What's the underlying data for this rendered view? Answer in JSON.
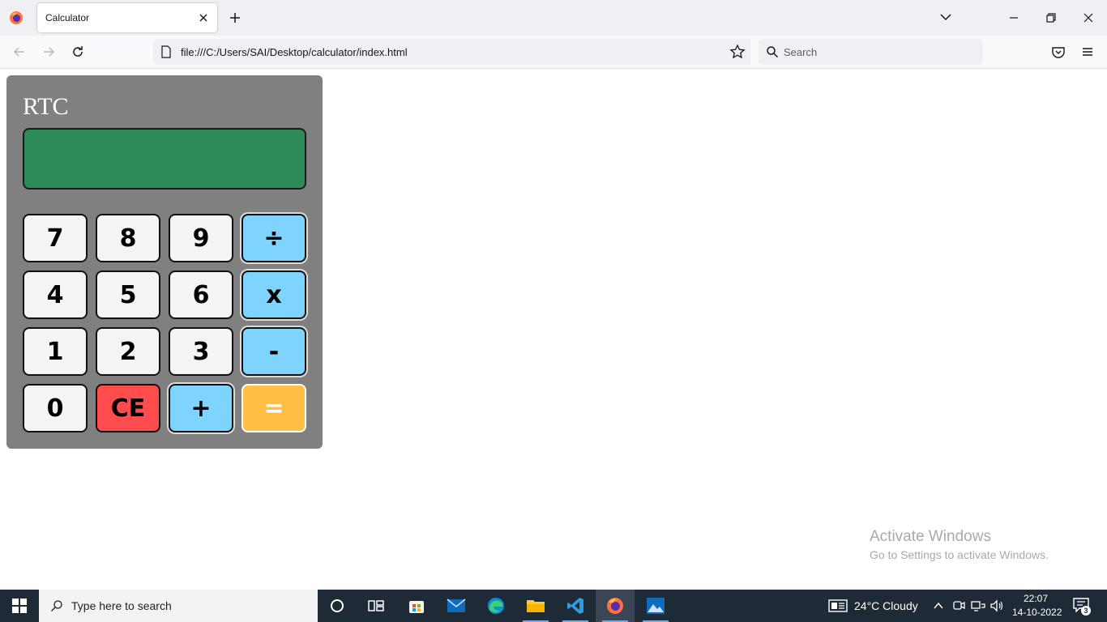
{
  "browser": {
    "tab_title": "Calculator",
    "url": "file:///C:/Users/SAI/Desktop/calculator/index.html",
    "search_placeholder": "Search"
  },
  "calculator": {
    "title": "RTC",
    "display_value": "",
    "keys": [
      "7",
      "8",
      "9",
      "÷",
      "4",
      "5",
      "6",
      "x",
      "1",
      "2",
      "3",
      "-",
      "0",
      "CE",
      "+",
      "="
    ],
    "colors": {
      "body": "#808080",
      "display": "#2e8b57",
      "number_key": "#f4f4f4",
      "operator_key": "#7fd4ff",
      "clear_key": "#ff4d4d",
      "equals_key": "#ffbf47"
    }
  },
  "watermark": {
    "line1": "Activate Windows",
    "line2": "Go to Settings to activate Windows."
  },
  "taskbar": {
    "search_placeholder": "Type here to search",
    "weather": "24°C  Cloudy",
    "time": "22:07",
    "date": "14-10-2022",
    "notification_count": "3"
  }
}
